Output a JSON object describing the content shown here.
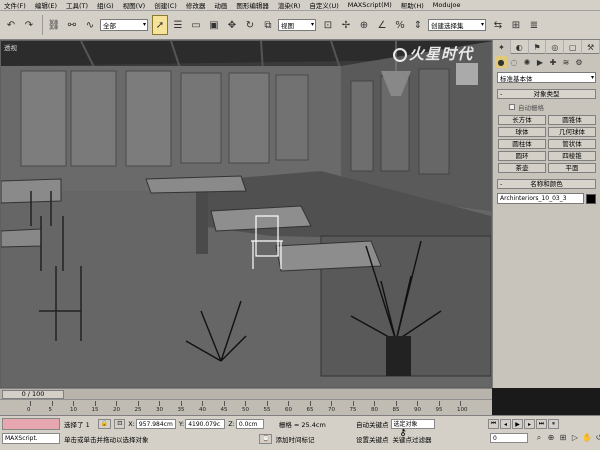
{
  "menu": [
    "文件(F)",
    "编辑(E)",
    "工具(T)",
    "组(G)",
    "视图(V)",
    "创建(C)",
    "修改器",
    "动画",
    "图形编辑器",
    "渲染(R)",
    "自定义(U)",
    "MAXScript(M)",
    "帮助(H)",
    "ModuJoe"
  ],
  "toolbar": {
    "selection_filter": "全部",
    "ref_coord": "视图",
    "named_selection": "创建选择集"
  },
  "viewport": {
    "label": "透视",
    "watermark": "火星时代"
  },
  "command_panel": {
    "category": "标准基本体",
    "object_type_title": "对象类型",
    "autogrid_label": "自动栅格",
    "objects": [
      "长方体",
      "圆锥体",
      "球体",
      "几何球体",
      "圆柱体",
      "管状体",
      "圆环",
      "四棱锥",
      "茶壶",
      "平面"
    ],
    "name_color_title": "名称和颜色",
    "object_name": "Archinteriors_10_03_3"
  },
  "timeline": {
    "slider": "0 / 100",
    "ticks": [
      "0",
      "5",
      "10",
      "15",
      "20",
      "25",
      "30",
      "35",
      "40",
      "45",
      "50",
      "55",
      "60",
      "65",
      "70",
      "75",
      "80",
      "85",
      "90",
      "95",
      "100"
    ]
  },
  "status": {
    "selection": "选择了 1",
    "x_label": "X:",
    "x_value": "957.984cm",
    "y_label": "Y:",
    "y_value": "4190.079c",
    "z_label": "Z:",
    "z_value": "0.0cm",
    "grid": "栅格 = 25.4cm",
    "autokey": "自动关键点",
    "selected_obj": "选定对象",
    "setkey": "设置关键点",
    "keyfilter": "关键点过滤器",
    "prompt": "单击或单击并拖动以选择对象",
    "add_time_tag": "添加时间标记",
    "maxscript_label": "MAXScript.",
    "frame": "0"
  },
  "colors": {
    "ui_gray": "#d4d0c8",
    "viewport_bg": "#1e1e1e",
    "maxscript_pink": "#e6a7b0",
    "active_yellow": "#f6e39a"
  }
}
